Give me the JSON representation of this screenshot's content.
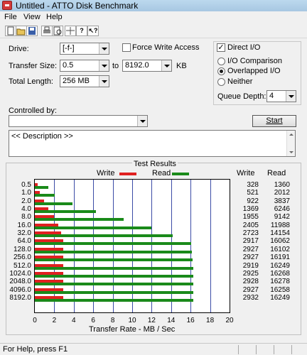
{
  "window": {
    "title": "Untitled - ATTO Disk Benchmark"
  },
  "menu": [
    "File",
    "View",
    "Help"
  ],
  "toolbar": {
    "icons": [
      "new-icon",
      "open-icon",
      "save-icon",
      "print-icon",
      "print-preview-icon",
      "move-icon",
      "help-icon",
      "context-help-icon"
    ]
  },
  "form": {
    "drive_label": "Drive:",
    "drive_value": "[-f-]",
    "transfer_size_label": "Transfer Size:",
    "transfer_from": "0.5",
    "to_label": "to",
    "transfer_to": "8192.0",
    "kb_label": "KB",
    "total_length_label": "Total Length:",
    "total_length_value": "256 MB",
    "force_write_label": "Force Write Access",
    "force_write_checked": false,
    "direct_io_label": "Direct I/O",
    "direct_io_checked": true,
    "io_comparison_label": "I/O Comparison",
    "overlapped_io_label": "Overlapped I/O",
    "neither_label": "Neither",
    "selected_mode": "Overlapped I/O",
    "queue_depth_label": "Queue Depth:",
    "queue_depth_value": "4",
    "controlled_by_label": "Controlled by:",
    "controlled_by_value": "",
    "start_label": "Start",
    "description_text": "<< Description >>"
  },
  "results": {
    "group_title": "Test Results",
    "legend_write": "Write",
    "legend_read": "Read",
    "write_header": "Write",
    "read_header": "Read",
    "write_color": "#e02020",
    "read_color": "#1a8a1a"
  },
  "chart_data": {
    "type": "bar",
    "orientation": "horizontal",
    "xlabel": "Transfer Rate - MB / Sec",
    "xlim": [
      0,
      20
    ],
    "xticks": [
      0,
      2,
      4,
      6,
      8,
      10,
      12,
      14,
      16,
      18,
      20
    ],
    "categories": [
      "0.5",
      "1.0",
      "2.0",
      "4.0",
      "8.0",
      "16.0",
      "32.0",
      "64.0",
      "128.0",
      "256.0",
      "512.0",
      "1024.0",
      "2048.0",
      "4096.0",
      "8192.0"
    ],
    "series": [
      {
        "name": "Write",
        "values": [
          328,
          521,
          922,
          1369,
          1955,
          2405,
          2723,
          2917,
          2927,
          2927,
          2919,
          2925,
          2928,
          2927,
          2932
        ]
      },
      {
        "name": "Read",
        "values": [
          1360,
          2012,
          3837,
          6246,
          9142,
          11988,
          14154,
          16062,
          16102,
          16191,
          16249,
          16268,
          16278,
          16258,
          16249
        ]
      }
    ]
  },
  "status": {
    "text": "For Help, press F1"
  }
}
